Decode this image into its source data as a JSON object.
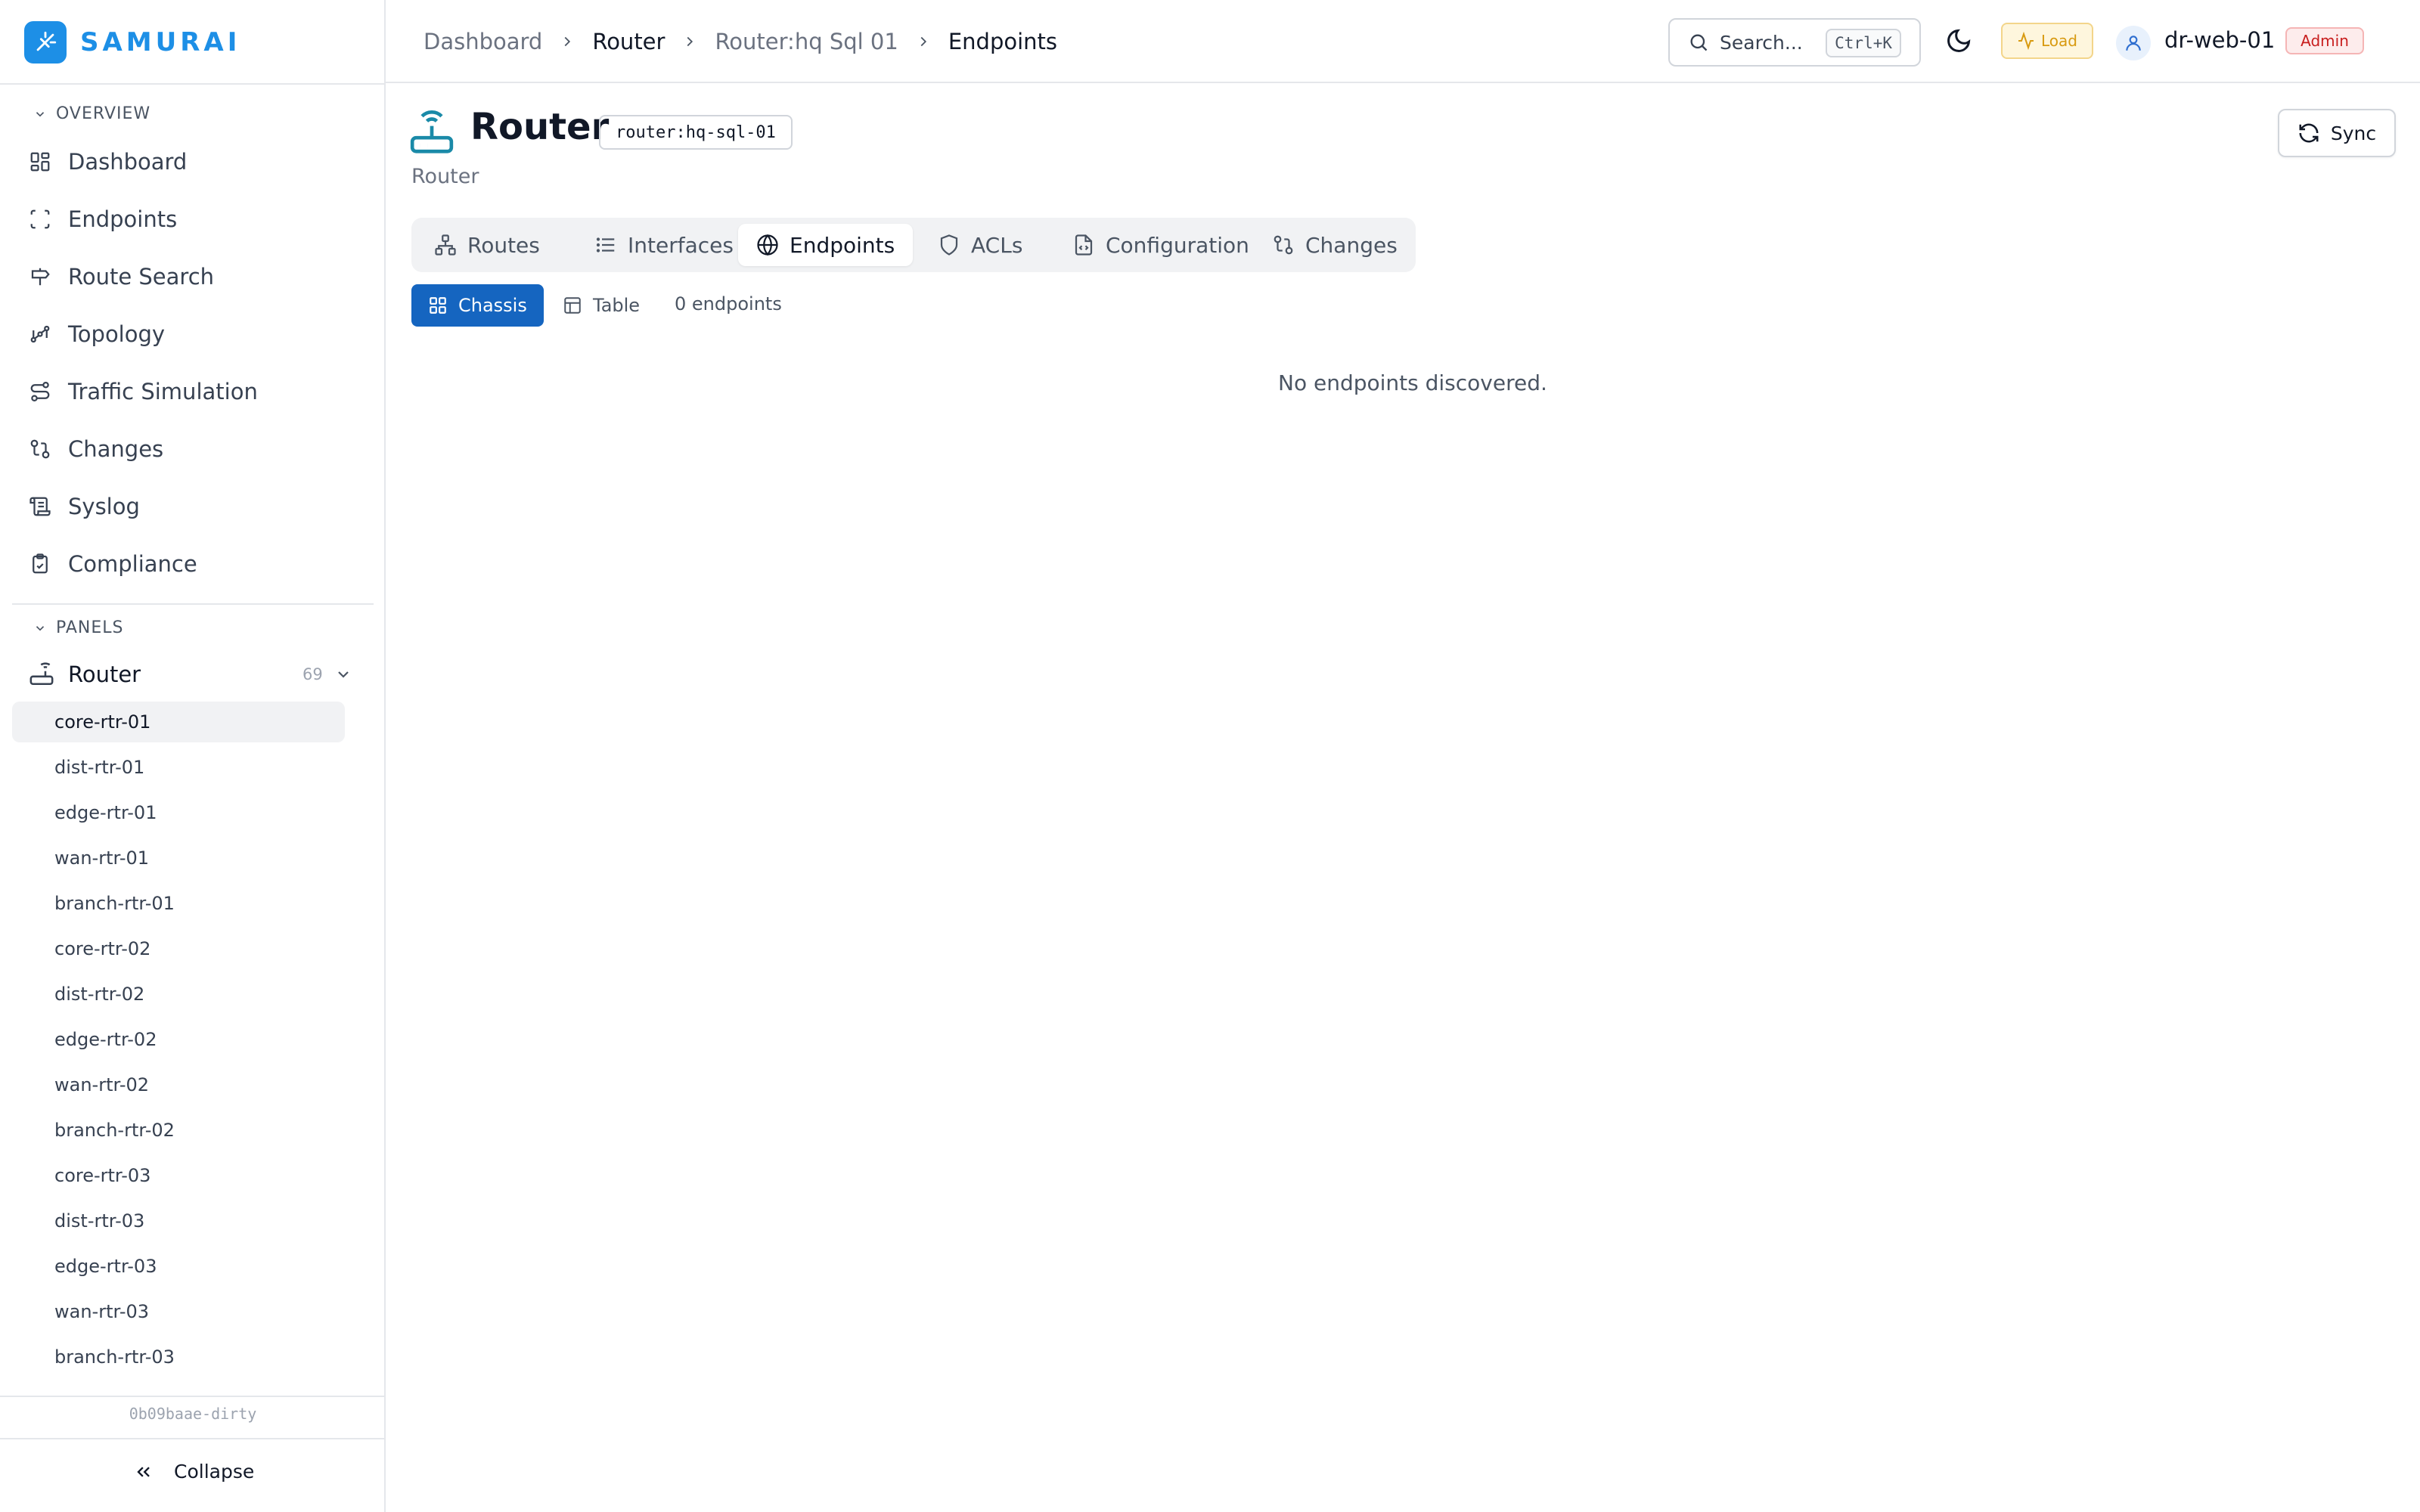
{
  "app": {
    "name": "SAMURAI",
    "version": "0b09baae-dirty"
  },
  "sidebar": {
    "overview_label": "OVERVIEW",
    "nav": [
      {
        "label": "Dashboard",
        "icon": "grid-icon"
      },
      {
        "label": "Endpoints",
        "icon": "scan-icon"
      },
      {
        "label": "Route Search",
        "icon": "signpost-icon"
      },
      {
        "label": "Topology",
        "icon": "topology-icon"
      },
      {
        "label": "Traffic Simulation",
        "icon": "route-icon"
      },
      {
        "label": "Changes",
        "icon": "git-compare-icon"
      },
      {
        "label": "Syslog",
        "icon": "scroll-icon"
      },
      {
        "label": "Compliance",
        "icon": "clipboard-check-icon"
      }
    ],
    "panels_label": "PANELS",
    "router_group": {
      "label": "Router",
      "count": "69"
    },
    "routers": [
      "core-rtr-01",
      "dist-rtr-01",
      "edge-rtr-01",
      "wan-rtr-01",
      "branch-rtr-01",
      "core-rtr-02",
      "dist-rtr-02",
      "edge-rtr-02",
      "wan-rtr-02",
      "branch-rtr-02",
      "core-rtr-03",
      "dist-rtr-03",
      "edge-rtr-03",
      "wan-rtr-03",
      "branch-rtr-03"
    ],
    "active_router": "core-rtr-01",
    "collapse_label": "Collapse"
  },
  "header": {
    "breadcrumbs": [
      "Dashboard",
      "Router",
      "Router:hq Sql 01",
      "Endpoints"
    ],
    "search_placeholder": "Search...",
    "search_shortcut": "Ctrl+K",
    "load_label": "Load",
    "username": "dr-web-01",
    "role": "Admin"
  },
  "page": {
    "title": "Router",
    "id": "router:hq-sql-01",
    "subtitle": "Router",
    "sync_label": "Sync",
    "tabs": [
      "Routes",
      "Interfaces",
      "Endpoints",
      "ACLs",
      "Configuration",
      "Changes"
    ],
    "active_tab": "Endpoints",
    "views": [
      "Chassis",
      "Table"
    ],
    "active_view": "Chassis",
    "endpoint_count": "0 endpoints",
    "empty_message": "No endpoints discovered."
  },
  "colors": {
    "brand": "#1d8fe6",
    "primary": "#1565c0",
    "load": "#d89a10",
    "admin": "#c81e1e",
    "router_icon": "#1a8aa8"
  }
}
